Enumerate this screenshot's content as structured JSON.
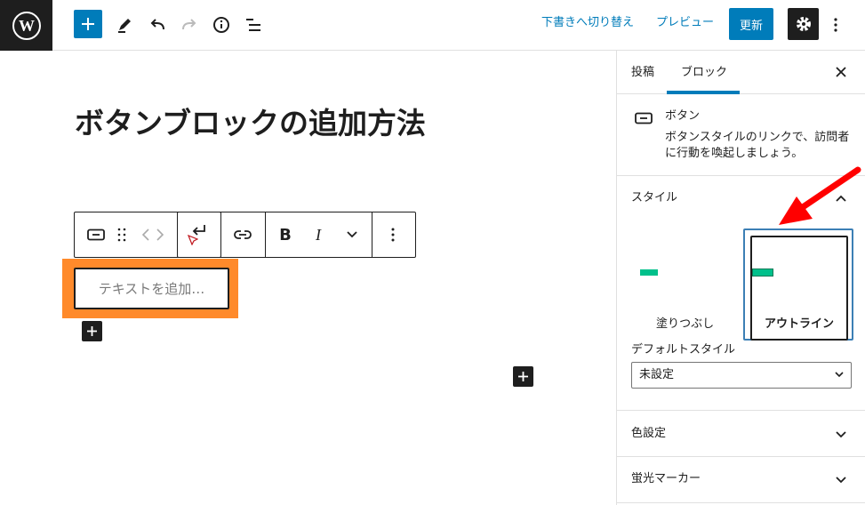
{
  "topbar": {
    "switch_to_draft_label": "下書きへ切り替え",
    "preview_label": "プレビュー",
    "update_label": "更新"
  },
  "editor": {
    "post_title": "ボタンブロックの追加方法",
    "button_placeholder": "テキストを追加…",
    "toolbar": {
      "bold_label": "B",
      "italic_label": "I"
    }
  },
  "sidebar": {
    "tabs": [
      {
        "label": "投稿"
      },
      {
        "label": "ブロック"
      }
    ],
    "active_tab": "ブロック",
    "block_card": {
      "title": "ボタン",
      "description": "ボタンスタイルのリンクで、訪問者に行動を喚起しましょう。"
    },
    "styles_panel": {
      "title": "スタイル",
      "options": [
        {
          "label": "塗りつぶし",
          "selected": false
        },
        {
          "label": "アウトライン",
          "selected": true
        }
      ],
      "default_style_label": "デフォルトスタイル",
      "default_style_value": "未設定"
    },
    "color_panel_title": "色設定",
    "highlighter_panel_title": "蛍光マーカー"
  },
  "colors": {
    "accent": "#007cba",
    "highlight_box": "#ff8a2b",
    "annotation_arrow": "#ff0000",
    "preview_button_green": "#00c08b"
  }
}
